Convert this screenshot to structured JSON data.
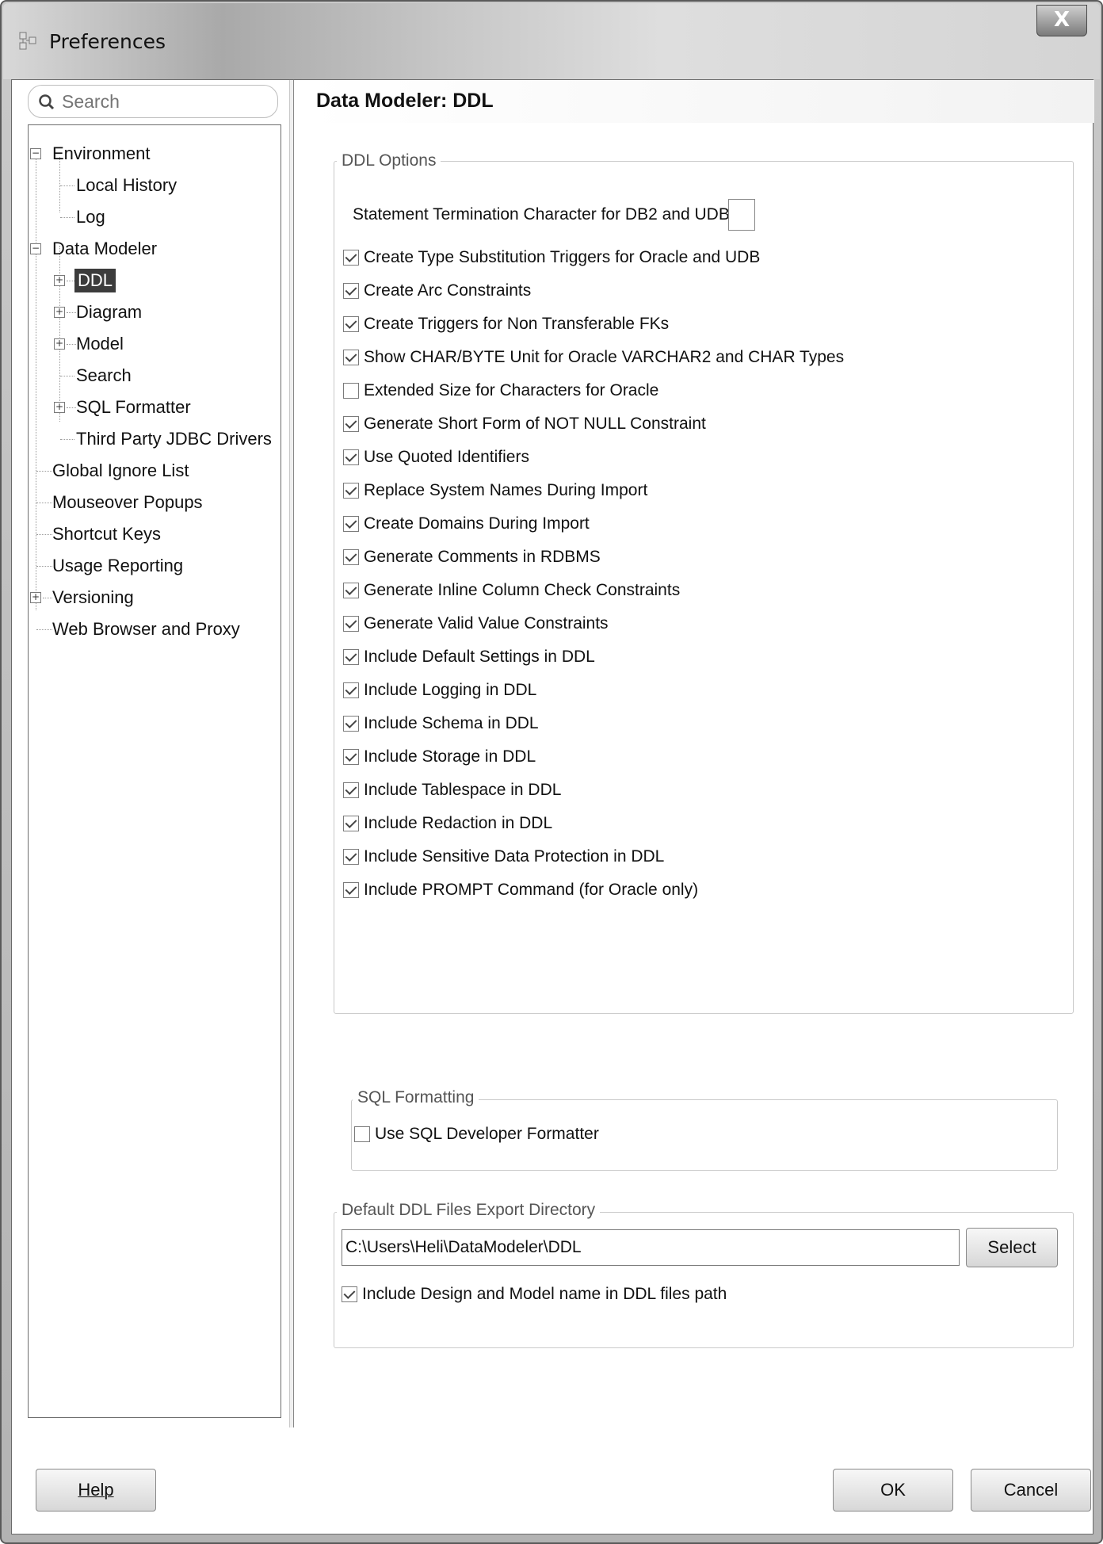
{
  "window": {
    "title": "Preferences",
    "close_label": "X"
  },
  "search": {
    "placeholder": "Search"
  },
  "tree": {
    "environment": "Environment",
    "local_history": "Local History",
    "log": "Log",
    "data_modeler": "Data Modeler",
    "ddl": "DDL",
    "diagram": "Diagram",
    "model": "Model",
    "search": "Search",
    "sql_formatter": "SQL Formatter",
    "third_party": "Third Party JDBC Drivers",
    "global_ignore": "Global Ignore List",
    "mouseover": "Mouseover Popups",
    "shortcut": "Shortcut Keys",
    "usage": "Usage Reporting",
    "versioning": "Versioning",
    "web_browser": "Web Browser and Proxy"
  },
  "page": {
    "title": "Data Modeler: DDL"
  },
  "ddl_options": {
    "legend": "DDL Options",
    "termination_label": "Statement Termination Character for DB2 and UDB:",
    "termination_value": "",
    "checkboxes": [
      {
        "label": "Create Type Substitution Triggers for Oracle and UDB",
        "checked": true
      },
      {
        "label": "Create Arc Constraints",
        "checked": true
      },
      {
        "label": "Create Triggers for Non Transferable FKs",
        "checked": true
      },
      {
        "label": "Show CHAR/BYTE Unit for Oracle VARCHAR2 and CHAR Types",
        "checked": true
      },
      {
        "label": "Extended Size for Characters for Oracle",
        "checked": false
      },
      {
        "label": "Generate Short Form of NOT NULL Constraint",
        "checked": true
      },
      {
        "label": "Use Quoted Identifiers",
        "checked": true
      },
      {
        "label": "Replace System Names During Import",
        "checked": true
      },
      {
        "label": "Create Domains During Import",
        "checked": true
      },
      {
        "label": "Generate Comments in RDBMS",
        "checked": true
      },
      {
        "label": "Generate Inline Column Check Constraints",
        "checked": true
      },
      {
        "label": "Generate Valid Value Constraints",
        "checked": true
      },
      {
        "label": "Include Default Settings in DDL",
        "checked": true
      },
      {
        "label": "Include Logging in DDL",
        "checked": true
      },
      {
        "label": "Include Schema in DDL",
        "checked": true
      },
      {
        "label": "Include Storage in DDL",
        "checked": true
      },
      {
        "label": "Include Tablespace in DDL",
        "checked": true
      },
      {
        "label": "Include Redaction in DDL",
        "checked": true
      },
      {
        "label": "Include Sensitive Data Protection in DDL",
        "checked": true
      },
      {
        "label": "Include PROMPT Command (for Oracle only)",
        "checked": true
      }
    ]
  },
  "sql_formatting": {
    "legend": "SQL Formatting",
    "use_formatter": {
      "label": "Use SQL Developer Formatter",
      "checked": false
    }
  },
  "export_dir": {
    "legend": "Default DDL Files Export Directory",
    "path": "C:\\Users\\Heli\\DataModeler\\DDL",
    "select_label": "Select",
    "include_design": {
      "label": "Include Design and Model name in DDL files path",
      "checked": true
    }
  },
  "footer": {
    "help": "Help",
    "ok": "OK",
    "cancel": "Cancel"
  }
}
